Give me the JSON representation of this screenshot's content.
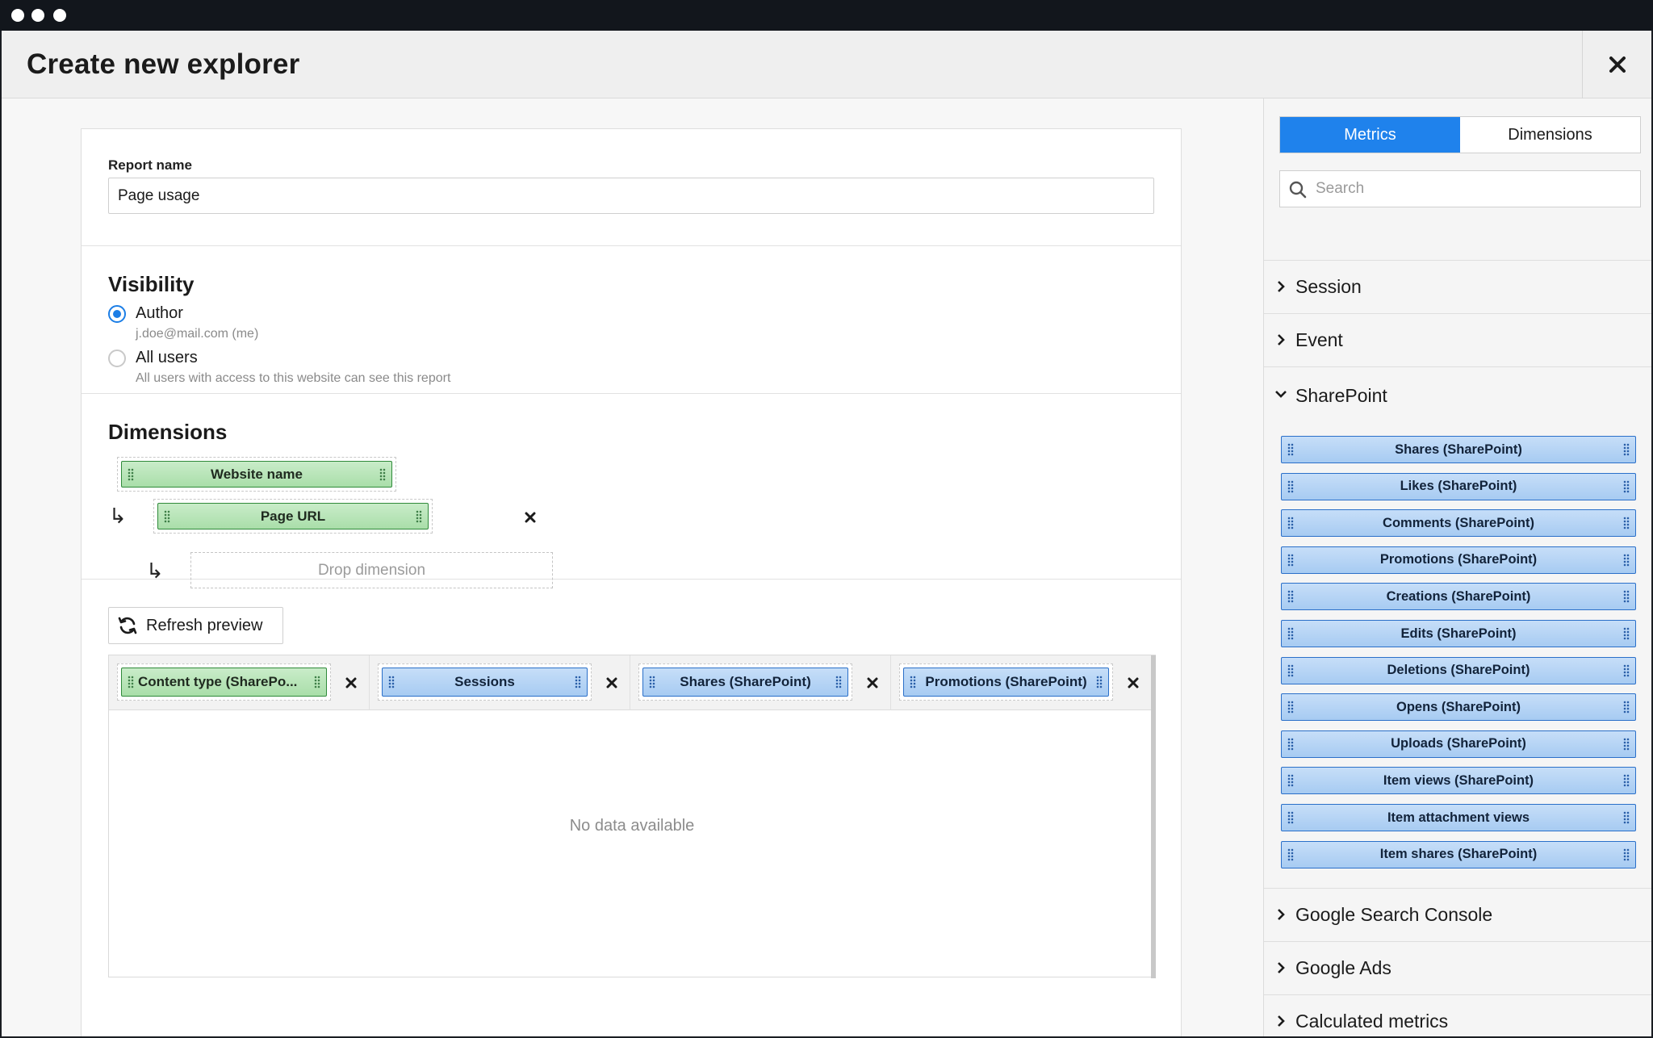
{
  "header": {
    "title": "Create new explorer"
  },
  "report": {
    "name_label": "Report name",
    "name_value": "Page usage"
  },
  "visibility": {
    "title": "Visibility",
    "options": [
      {
        "label": "Author",
        "sub": "j.doe@mail.com (me)",
        "selected": true
      },
      {
        "label": "All users",
        "sub": "All users with access to this website can see this report",
        "selected": false
      }
    ]
  },
  "dimensions": {
    "title": "Dimensions",
    "items": [
      "Website name",
      "Page URL"
    ],
    "drop_placeholder": "Drop dimension"
  },
  "preview": {
    "refresh_label": "Refresh preview",
    "columns": [
      {
        "label": "Content type (SharePo...",
        "kind": "dimension"
      },
      {
        "label": "Sessions",
        "kind": "metric"
      },
      {
        "label": "Shares (SharePoint)",
        "kind": "metric"
      },
      {
        "label": "Promotions (SharePoint)",
        "kind": "metric"
      }
    ],
    "empty_message": "No data available"
  },
  "panel": {
    "tabs": [
      {
        "label": "Metrics",
        "active": true
      },
      {
        "label": "Dimensions",
        "active": false
      }
    ],
    "search_placeholder": "Search",
    "categories_top": [
      {
        "label": "Session",
        "expanded": false
      },
      {
        "label": "Event",
        "expanded": false
      }
    ],
    "expanded_category": {
      "label": "SharePoint",
      "expanded": true
    },
    "metrics": [
      "Shares (SharePoint)",
      "Likes (SharePoint)",
      "Comments (SharePoint)",
      "Promotions (SharePoint)",
      "Creations (SharePoint)",
      "Edits (SharePoint)",
      "Deletions (SharePoint)",
      "Opens (SharePoint)",
      "Uploads (SharePoint)",
      "Item views (SharePoint)",
      "Item attachment views",
      "Item shares (SharePoint)"
    ],
    "categories_bottom": [
      {
        "label": "Google Search Console",
        "expanded": false
      },
      {
        "label": "Google Ads",
        "expanded": false
      },
      {
        "label": "Calculated metrics",
        "expanded": false
      }
    ]
  },
  "colors": {
    "accent": "#1f82ec",
    "dimension_green": "#a9dea9",
    "metric_blue": "#a7cbf2"
  }
}
